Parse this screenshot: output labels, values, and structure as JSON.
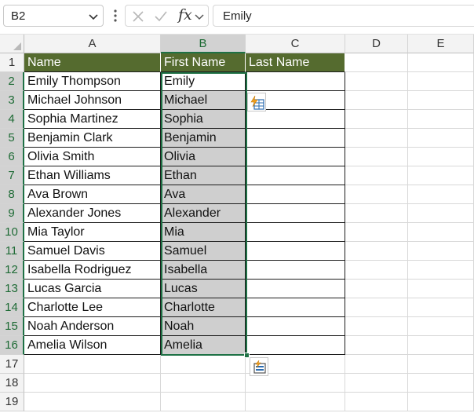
{
  "formula_bar": {
    "name_box": "B2",
    "formula": "Emily",
    "fx_label": "fx"
  },
  "columns": [
    "A",
    "B",
    "C",
    "D",
    "E"
  ],
  "rows": [
    "1",
    "2",
    "3",
    "4",
    "5",
    "6",
    "7",
    "8",
    "9",
    "10",
    "11",
    "12",
    "13",
    "14",
    "15",
    "16",
    "17",
    "18",
    "19"
  ],
  "sheet": {
    "headers": {
      "a": "Name",
      "b": "First Name",
      "c": "Last Name"
    },
    "data": [
      {
        "a": "Emily Thompson",
        "b": "Emily",
        "c": ""
      },
      {
        "a": "Michael Johnson",
        "b": "Michael",
        "c": ""
      },
      {
        "a": "Sophia Martinez",
        "b": "Sophia",
        "c": ""
      },
      {
        "a": "Benjamin Clark",
        "b": "Benjamin",
        "c": ""
      },
      {
        "a": "Olivia Smith",
        "b": "Olivia",
        "c": ""
      },
      {
        "a": "Ethan Williams",
        "b": "Ethan",
        "c": ""
      },
      {
        "a": "Ava Brown",
        "b": "Ava",
        "c": ""
      },
      {
        "a": "Alexander Jones",
        "b": "Alexander",
        "c": ""
      },
      {
        "a": "Mia Taylor",
        "b": "Mia",
        "c": ""
      },
      {
        "a": "Samuel Davis",
        "b": "Samuel",
        "c": ""
      },
      {
        "a": "Isabella Rodriguez",
        "b": "Isabella",
        "c": ""
      },
      {
        "a": "Lucas Garcia",
        "b": "Lucas",
        "c": ""
      },
      {
        "a": "Charlotte Lee",
        "b": "Charlotte",
        "c": ""
      },
      {
        "a": "Noah Anderson",
        "b": "Noah",
        "c": ""
      },
      {
        "a": "Amelia Wilson",
        "b": "Amelia",
        "c": ""
      }
    ]
  },
  "theme": {
    "header_fill": "#556b2f",
    "selection_border": "#1e7145",
    "selection_fill": "#cfcfcf"
  },
  "icons": {
    "flash_fill": "flash-fill-options-icon",
    "paste_options": "paste-options-icon"
  }
}
